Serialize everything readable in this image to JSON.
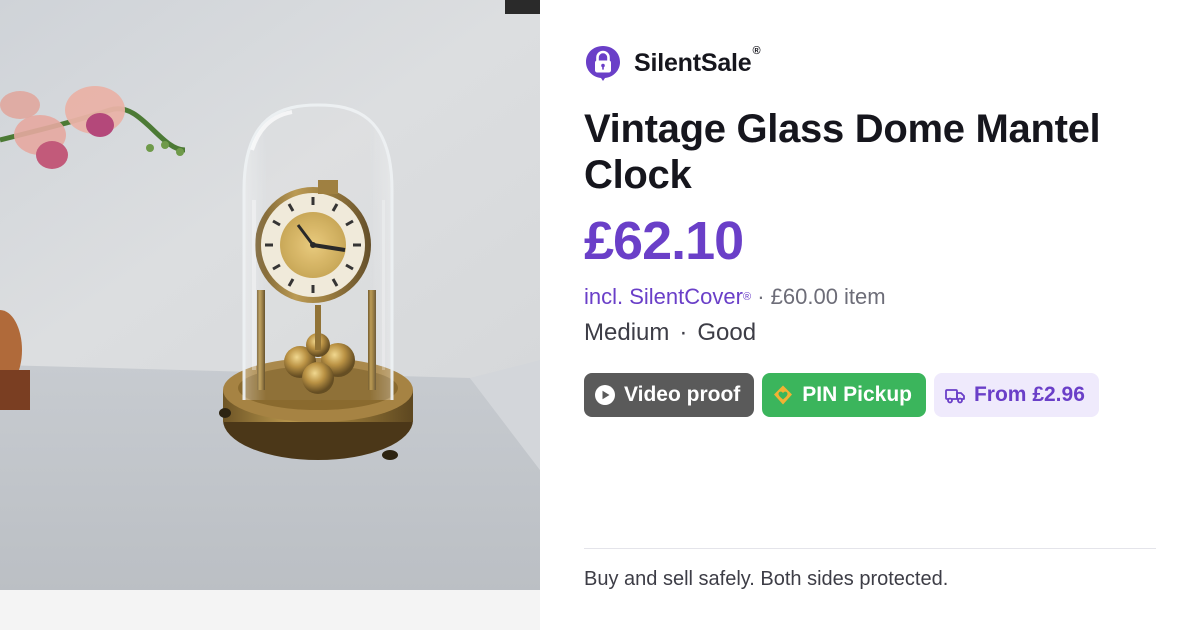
{
  "brand": {
    "name": "SilentSale",
    "registered_mark": "®",
    "logo_icon": "padlock-speech-bubble-icon",
    "accent_color": "#6a3fc8"
  },
  "listing": {
    "title": "Vintage Glass Dome Mantel Clock",
    "price": "£62.10",
    "fee_prefix": "incl. SilentCover",
    "fee_registered_mark": "®",
    "fee_separator": "·",
    "item_price": "£60.00 item",
    "size": "Medium",
    "meta_separator": "·",
    "condition": "Good",
    "photo_alt": "Brass anniversary clock under a glass dome on a white shelf"
  },
  "chips": {
    "video": {
      "label": "Video proof",
      "icon": "play-circle-icon",
      "color": "#5a5a5a"
    },
    "pin": {
      "label": "PIN Pickup",
      "icon": "shield-heart-icon",
      "color": "#3bb55c"
    },
    "shipping": {
      "label": "From £2.96",
      "icon": "truck-icon",
      "color": "#efeafc"
    }
  },
  "footer": {
    "tagline": "Buy and sell safely. Both sides protected."
  }
}
